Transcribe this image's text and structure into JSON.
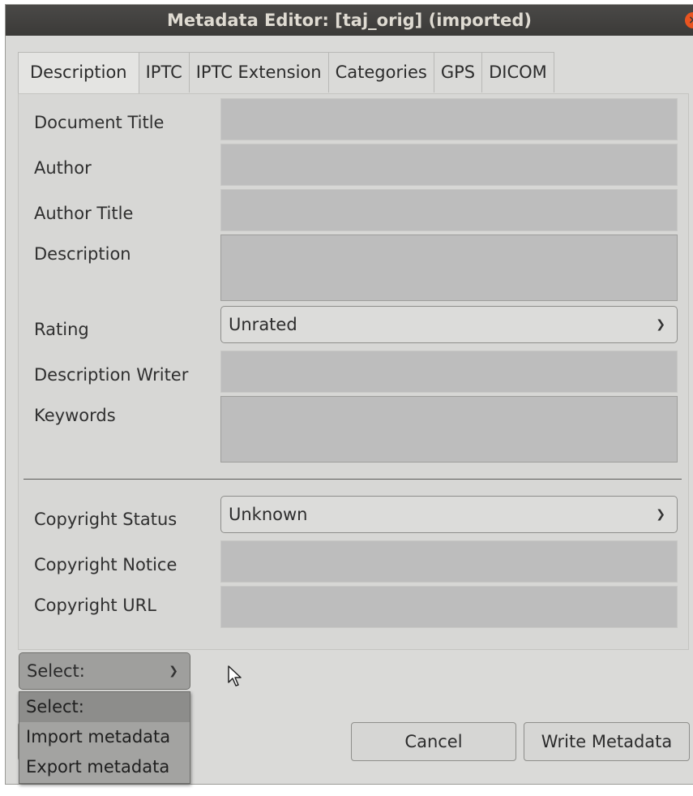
{
  "window": {
    "title": "Metadata Editor: [taj_orig] (imported)",
    "close_icon": "×"
  },
  "tabs": [
    {
      "label": "Description",
      "active": true
    },
    {
      "label": "IPTC"
    },
    {
      "label": "IPTC Extension"
    },
    {
      "label": "Categories"
    },
    {
      "label": "GPS"
    },
    {
      "label": "DICOM"
    }
  ],
  "form": {
    "document_title": {
      "label": "Document Title",
      "value": ""
    },
    "author": {
      "label": "Author",
      "value": ""
    },
    "author_title": {
      "label": "Author Title",
      "value": ""
    },
    "description": {
      "label": "Description",
      "value": ""
    },
    "rating": {
      "label": "Rating",
      "value": "Unrated"
    },
    "description_writer": {
      "label": "Description Writer",
      "value": ""
    },
    "keywords": {
      "label": "Keywords",
      "value": ""
    },
    "copyright_status": {
      "label": "Copyright Status",
      "value": "Unknown"
    },
    "copyright_notice": {
      "label": "Copyright Notice",
      "value": ""
    },
    "copyright_url": {
      "label": "Copyright URL",
      "value": ""
    }
  },
  "select_menu": {
    "value": "Select:",
    "options": [
      "Select:",
      "Import metadata",
      "Export metadata"
    ]
  },
  "buttons": {
    "cancel": "Cancel",
    "write": "Write Metadata"
  },
  "colors": {
    "titlebar": "#3b3a38",
    "close": "#e95420"
  }
}
